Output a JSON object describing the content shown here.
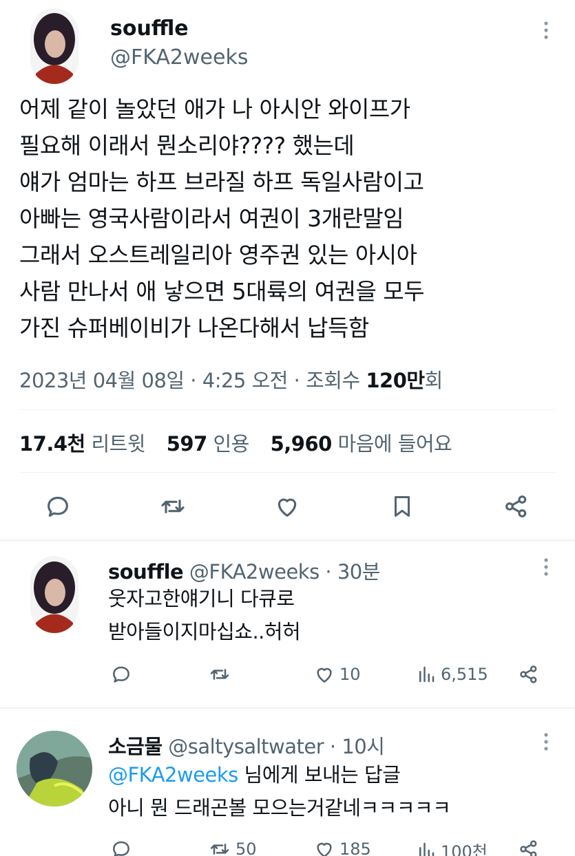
{
  "main_tweet": {
    "display_name": "souffle",
    "handle": "@FKA2weeks",
    "body_lines": [
      "어제 같이 놀았던 애가 나 아시안 와이프가",
      "필요해 이래서 뭔소리야???? 했는데",
      "얘가 엄마는 하프 브라질 하프 독일사람이고",
      "아빠는 영국사람이라서 여권이 3개란말임",
      "그래서 오스트레일리아 영주권 있는 아시아",
      "사람 만나서 애 낳으면 5대륙의 여권을 모두",
      "가진 슈퍼베이비가 나온다해서 납득함"
    ],
    "meta_prefix": "2023년 04월 08일 · 4:25 오전 · 조회수 ",
    "views": "120만",
    "views_suffix": "회",
    "stats": {
      "retweets_num": "17.4천",
      "retweets_label": "리트윗",
      "quotes_num": "597",
      "quotes_label": "인용",
      "likes_num": "5,960",
      "likes_label": "마음에 들어요"
    }
  },
  "replies": [
    {
      "display_name": "souffle",
      "handle": "@FKA2weeks · 30분",
      "lines": [
        "웃자고한얘기니 다큐로",
        "받아들이지마십쇼..허허"
      ],
      "retweets": "",
      "likes": "10",
      "views": "6,515"
    },
    {
      "display_name": "소금물",
      "handle": "@saltysaltwater · 10시",
      "reply_to_mention": "@FKA2weeks",
      "reply_to_suffix": " 님에게 보내는 답글",
      "lines": [
        "아니 뭔 드래곤볼 모으는거같네ㅋㅋㅋㅋㅋ"
      ],
      "retweets": "50",
      "likes": "185",
      "views": "100천"
    }
  ],
  "colors": {
    "text": "#0f1419",
    "secondary": "#536471",
    "accent": "#1d9bf0",
    "divider": "#eff3f4"
  },
  "icons": [
    "reply-icon",
    "retweet-icon",
    "like-icon",
    "bookmark-icon",
    "share-icon",
    "views-icon",
    "more-icon"
  ]
}
